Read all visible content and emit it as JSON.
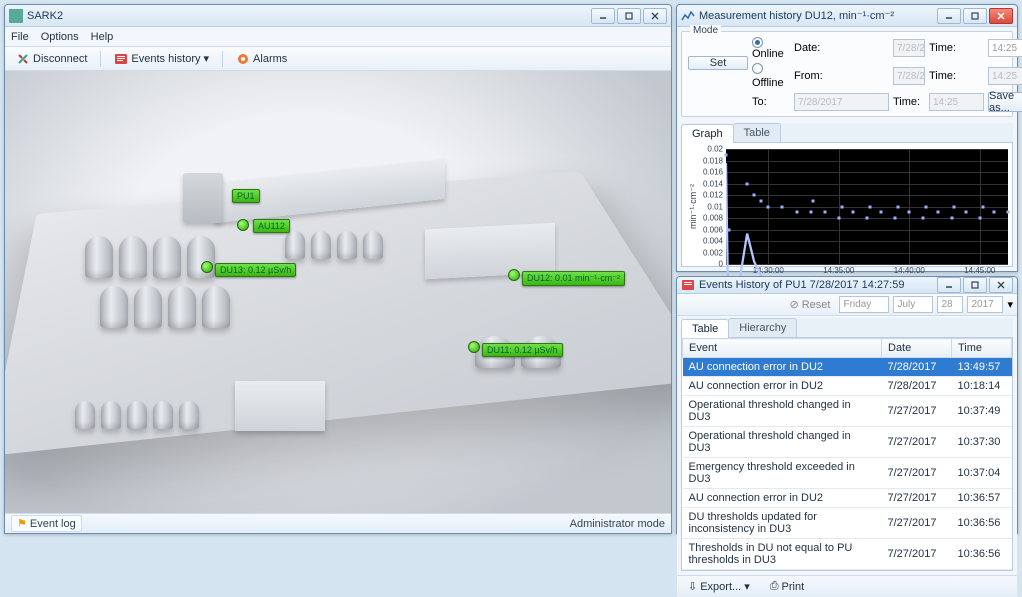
{
  "main": {
    "title": "SARK2",
    "menu": {
      "file": "File",
      "options": "Options",
      "help": "Help"
    },
    "toolbar": {
      "disconnect": "Disconnect",
      "events": "Events history",
      "alarms": "Alarms"
    },
    "markers": {
      "pu1": "PU1",
      "au112": "AU112",
      "du13": "DU13: 0.12 µSv/h",
      "du12": "DU12: 0.01 min⁻¹·cm⁻²",
      "du11": "DU11: 0.12 µSv/h"
    },
    "status": {
      "eventlog": "Event log",
      "mode": "Administrator mode"
    }
  },
  "meas": {
    "title": "Measurement history DU12, min⁻¹·cm⁻²",
    "mode_label": "Mode",
    "online": "Online",
    "offline": "Offline",
    "date": "Date:",
    "from": "From:",
    "to": "To:",
    "time": "Time:",
    "date_val": "7/28/2017",
    "time_val": "14:25",
    "set": "Set",
    "saveas": "Save as...",
    "tabs": {
      "graph": "Graph",
      "table": "Table"
    },
    "ylabel": "min⁻¹·cm⁻²"
  },
  "chart_data": {
    "type": "line",
    "xlabel": "",
    "ylabel": "min⁻¹·cm⁻²",
    "ylim": [
      0,
      0.02
    ],
    "yticks": [
      0,
      0.002,
      0.004,
      0.006,
      0.008,
      0.01,
      0.012,
      0.014,
      0.016,
      0.018,
      0.02
    ],
    "xticks": [
      "14:30:00",
      "14:35:00",
      "14:40:00",
      "14:45:00"
    ],
    "series": [
      {
        "name": "DU12",
        "x_minutes": [
          27,
          27.2,
          28.5,
          29,
          29.5,
          30,
          31,
          32,
          33,
          33.2,
          34,
          35,
          35.2,
          36,
          37,
          37.2,
          38,
          39,
          39.2,
          40,
          41,
          41.2,
          42,
          43,
          43.2,
          44,
          45,
          45.2,
          46,
          47
        ],
        "y": [
          0.019,
          0.006,
          0.014,
          0.012,
          0.011,
          0.01,
          0.01,
          0.009,
          0.009,
          0.011,
          0.009,
          0.008,
          0.01,
          0.009,
          0.008,
          0.01,
          0.009,
          0.008,
          0.01,
          0.009,
          0.008,
          0.01,
          0.009,
          0.008,
          0.01,
          0.009,
          0.008,
          0.01,
          0.009,
          0.009
        ]
      }
    ]
  },
  "events": {
    "title": "Events History of PU1 7/28/2017 14:27:59",
    "reset": "Reset",
    "day": "Friday",
    "month": "July",
    "dnum": "28",
    "year": "2017",
    "tabs": {
      "table": "Table",
      "hierarchy": "Hierarchy"
    },
    "cols": {
      "event": "Event",
      "date": "Date",
      "time": "Time"
    },
    "rows": [
      {
        "e": "AU connection error in DU2",
        "d": "7/28/2017",
        "t": "13:49:57",
        "sel": true
      },
      {
        "e": "AU connection error in DU2",
        "d": "7/28/2017",
        "t": "10:18:14"
      },
      {
        "e": "Operational threshold changed in DU3",
        "d": "7/27/2017",
        "t": "10:37:49"
      },
      {
        "e": "Operational threshold changed in DU3",
        "d": "7/27/2017",
        "t": "10:37:30"
      },
      {
        "e": "Emergency threshold exceeded in DU3",
        "d": "7/27/2017",
        "t": "10:37:04"
      },
      {
        "e": "AU connection error in DU2",
        "d": "7/27/2017",
        "t": "10:36:57"
      },
      {
        "e": "DU thresholds updated for inconsistency in DU3",
        "d": "7/27/2017",
        "t": "10:36:56"
      },
      {
        "e": "Thresholds in DU not equal to PU thresholds in DU3",
        "d": "7/27/2017",
        "t": "10:36:56"
      }
    ],
    "export": "Export...",
    "print": "Print"
  }
}
